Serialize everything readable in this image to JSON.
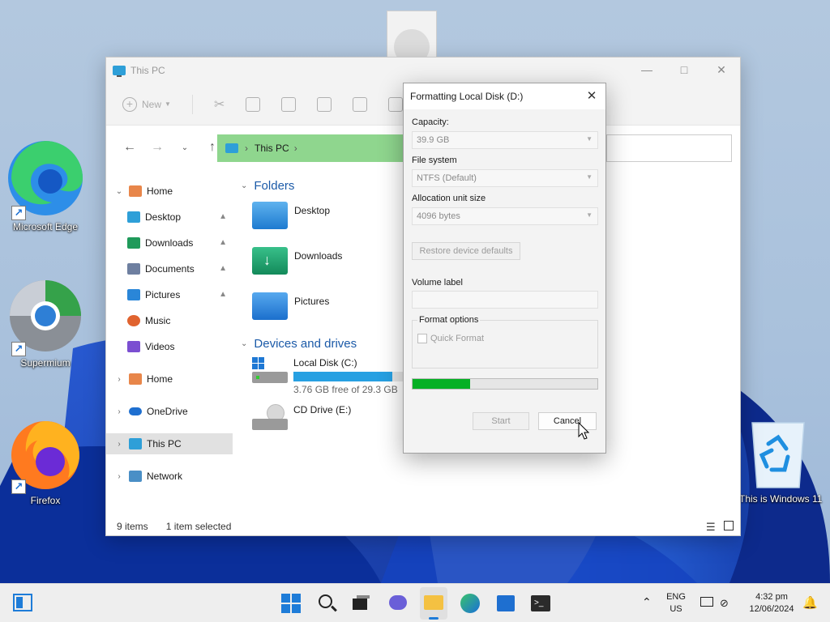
{
  "desktop": {
    "icons": [
      {
        "label": "Microsoft Edge"
      },
      {
        "label": "Supermium"
      },
      {
        "label": "Firefox"
      },
      {
        "label": "This is Windows 11"
      }
    ]
  },
  "explorer": {
    "title": "This PC",
    "toolbar": {
      "new_label": "New"
    },
    "address": {
      "location": "This PC"
    },
    "sidebar": {
      "home": "Home",
      "quick": [
        {
          "label": "Desktop",
          "icon": "desktop-icon",
          "color": "#2e9fd8"
        },
        {
          "label": "Downloads",
          "icon": "download-icon",
          "color": "#1f9a5a"
        },
        {
          "label": "Documents",
          "icon": "document-icon",
          "color": "#6e7fa0"
        },
        {
          "label": "Pictures",
          "icon": "pictures-icon",
          "color": "#2a86d8"
        },
        {
          "label": "Music",
          "icon": "music-icon",
          "color": "#e0632f"
        },
        {
          "label": "Videos",
          "icon": "videos-icon",
          "color": "#7b4fd1"
        }
      ],
      "home2": "Home",
      "onedrive": "OneDrive",
      "thispc": "This PC",
      "network": "Network"
    },
    "content": {
      "folders_heading": "Folders",
      "folders": [
        {
          "name": "Desktop",
          "color": "#2e8fd8"
        },
        {
          "name": "Downloads",
          "color": "#1f9a6a"
        },
        {
          "name": "Pictures",
          "color": "#2a86d8"
        }
      ],
      "devices_heading": "Devices and drives",
      "drives": [
        {
          "name": "Local Disk (C:)",
          "free": "3.76 GB free of 29.3 GB",
          "used_fraction": 0.87
        },
        {
          "name": "CD Drive (E:)"
        }
      ]
    },
    "status": {
      "items": "9 items",
      "selected": "1 item selected"
    }
  },
  "dialog": {
    "title": "Formatting Local Disk (D:)",
    "capacity_label": "Capacity:",
    "capacity_value": "39.9 GB",
    "fs_label": "File system",
    "fs_value": "NTFS (Default)",
    "alloc_label": "Allocation unit size",
    "alloc_value": "4096 bytes",
    "restore_button": "Restore device defaults",
    "volume_label": "Volume label",
    "volume_value": "",
    "format_options": "Format options",
    "quick_format": "Quick Format",
    "progress_fraction": 0.31,
    "start_button": "Start",
    "cancel_button": "Cancel"
  },
  "taskbar": {
    "lang_top": "ENG",
    "lang_bottom": "US",
    "time": "4:32 pm",
    "date": "12/06/2024",
    "colors": {
      "accent": "#0067c0",
      "progress": "#06b025",
      "address_bg": "#8fd68e"
    }
  }
}
